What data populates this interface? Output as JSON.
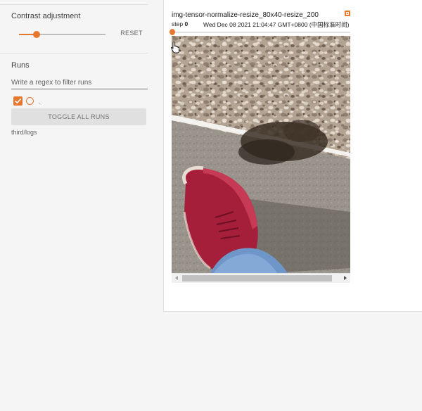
{
  "sidebar": {
    "contrast": {
      "title": "Contrast adjustment",
      "value_fraction": 0.2,
      "reset_label": "RESET"
    },
    "runs": {
      "title": "Runs",
      "filter_placeholder": "Write a regex to filter runs",
      "run": {
        "name": ".",
        "checked": true,
        "color": "#e8772e"
      },
      "toggle_all_label": "TOGGLE ALL RUNS",
      "logdir": "third/logs"
    }
  },
  "card": {
    "title": "img-tensor-normalize-resize_80x40-resize_200",
    "step_prefix": "step",
    "step_value": "0",
    "timestamp": "Wed Dec 08 2021 21:04:47 GMT+0800 (中国标准时间)",
    "image_description_icon": "photo-of-red-sneaker-on-pavement"
  },
  "colors": {
    "accent": "#e8772e",
    "sidebar_bg": "#f5f5f5",
    "card_bg": "#ffffff"
  }
}
